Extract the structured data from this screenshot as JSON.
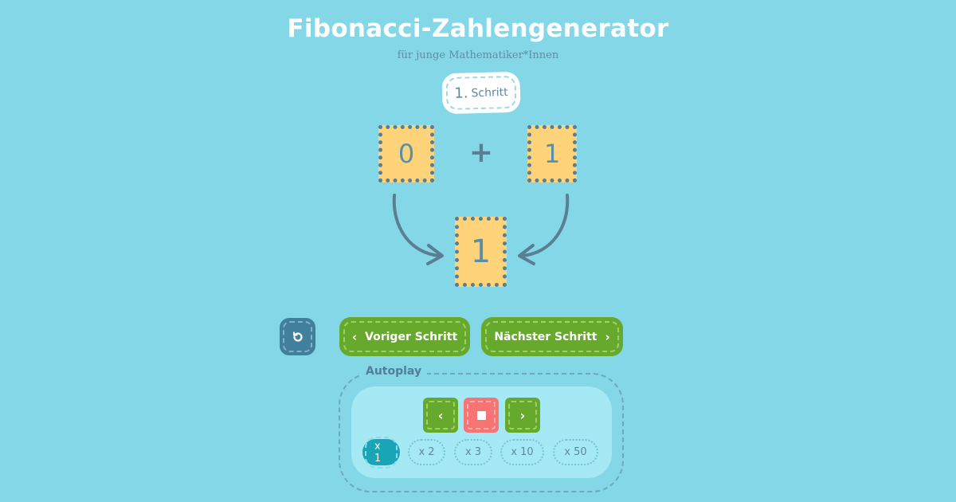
{
  "header": {
    "title": "Fibonacci-Zahlengenerator",
    "subtitle": "für junge Mathematiker*Innen"
  },
  "step": {
    "number": "1.",
    "label": "Schritt"
  },
  "equation": {
    "a": "0",
    "operator": "+",
    "b": "1",
    "result": "1"
  },
  "controls": {
    "reset_icon": "reset-icon",
    "prev_label": "Voriger Schritt",
    "next_label": "Nächster Schritt",
    "prev_chevron": "‹",
    "next_chevron": "›"
  },
  "autoplay": {
    "legend": "Autoplay",
    "prev_icon": "‹",
    "next_icon": "›",
    "speeds": [
      "x 1",
      "x 2",
      "x 3",
      "x 10",
      "x 50"
    ],
    "active_speed": "x 1"
  },
  "colors": {
    "background": "#84d7e6",
    "number_box": "#ffd37a",
    "green_button": "#67a92c",
    "stop_button": "#f87374",
    "reset_button": "#417f9d",
    "active_speed": "#1aa5b6"
  }
}
